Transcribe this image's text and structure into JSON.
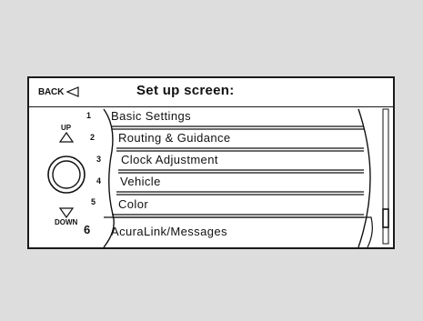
{
  "header": {
    "back_label": "BACK",
    "title": "Set up screen:"
  },
  "controls": {
    "up_label": "UP",
    "down_label": "DOWN"
  },
  "menu": {
    "items": [
      {
        "number": "1",
        "label": "Basic Settings"
      },
      {
        "number": "2",
        "label": "Routing & Guidance"
      },
      {
        "number": "3",
        "label": "Clock Adjustment"
      },
      {
        "number": "4",
        "label": "Vehicle"
      },
      {
        "number": "5",
        "label": "Color"
      },
      {
        "number": "6",
        "label": "AcuraLink/Messages"
      }
    ]
  },
  "icons": {
    "back": "back-triangle-icon",
    "up": "up-triangle-icon",
    "down": "down-triangle-icon",
    "knob": "interface-dial-icon"
  }
}
